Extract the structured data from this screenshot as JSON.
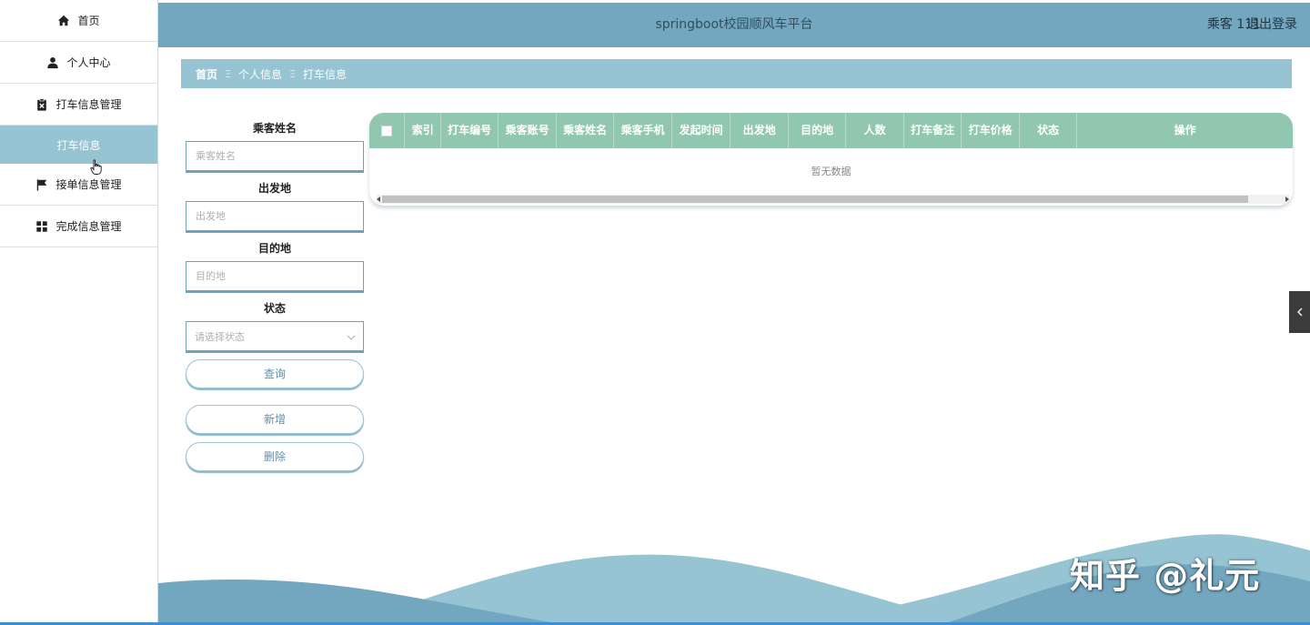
{
  "sidebar": {
    "items": [
      {
        "label": "首页",
        "icon": "home-icon"
      },
      {
        "label": "个人中心",
        "icon": "user-icon"
      },
      {
        "label": "打车信息管理",
        "icon": "clipboard-icon"
      },
      {
        "label": "打车信息",
        "icon": ""
      },
      {
        "label": "接单信息管理",
        "icon": "flag-icon"
      },
      {
        "label": "完成信息管理",
        "icon": "grid-icon"
      }
    ]
  },
  "header": {
    "title": "springboot校园顺风车平台",
    "user": "乘客 111",
    "logout": "退出登录"
  },
  "breadcrumb": {
    "home": "首页",
    "sep": "Ξ",
    "items": [
      "个人信息",
      "打车信息"
    ]
  },
  "search": {
    "name_label": "乘客姓名",
    "name_placeholder": "乘客姓名",
    "from_label": "出发地",
    "from_placeholder": "出发地",
    "to_label": "目的地",
    "to_placeholder": "目的地",
    "status_label": "状态",
    "status_placeholder": "请选择状态",
    "query_button": "查询",
    "add_button": "新增",
    "delete_button": "删除"
  },
  "table": {
    "columns": [
      "索引",
      "打车编号",
      "乘客账号",
      "乘客姓名",
      "乘客手机",
      "发起时间",
      "出发地",
      "目的地",
      "人数",
      "打车备注",
      "打车价格",
      "状态",
      "操作"
    ],
    "empty_text": "暂无数据"
  },
  "watermark": "知乎 @礼元",
  "colors": {
    "header_bg": "#73a7c0",
    "breadcrumb_bg": "#96c4d3",
    "table_header_bg": "#91c7ae",
    "active_menu_bg": "#96c4d3"
  }
}
